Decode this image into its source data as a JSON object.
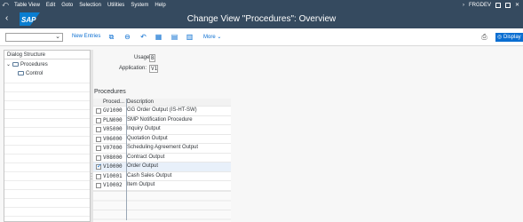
{
  "menu": {
    "items": [
      "Table View",
      "Edit",
      "Goto",
      "Selection",
      "Utilities",
      "System",
      "Help"
    ],
    "system_id": "FRGDEV"
  },
  "title": "Change View \"Procedures\": Overview",
  "logo_text": "SAP",
  "toolbar": {
    "new_entries": "New Entries",
    "more": "More",
    "display": "Display"
  },
  "dialog": {
    "header": "Dialog Structure",
    "items": [
      "Procedures",
      "Control"
    ]
  },
  "fields": {
    "usage_label": "Usage:",
    "usage_value": "B",
    "application_label": "Application:",
    "application_value": "V1"
  },
  "section_title": "Procedures",
  "table": {
    "columns": [
      "Proced...",
      "Description"
    ],
    "rows": [
      {
        "code": "GV1000",
        "desc": "GG Order Output (IS-HT-SW)",
        "checked": false
      },
      {
        "code": "PLN000",
        "desc": "SMP Notification Procedure",
        "checked": false
      },
      {
        "code": "V05000",
        "desc": "Inquiry Output",
        "checked": false
      },
      {
        "code": "V06000",
        "desc": "Quotation Output",
        "checked": false
      },
      {
        "code": "V07000",
        "desc": "Scheduling Agreement Output",
        "checked": false
      },
      {
        "code": "V08000",
        "desc": "Contract Output",
        "checked": false
      },
      {
        "code": "V10000",
        "desc": "Order Output",
        "checked": true
      },
      {
        "code": "V10001",
        "desc": "Cash Sales Output",
        "checked": false
      },
      {
        "code": "V10002",
        "desc": "Item Output",
        "checked": false
      }
    ]
  },
  "colors": {
    "shell": "#354a5f",
    "accent": "#0a6ed1"
  }
}
